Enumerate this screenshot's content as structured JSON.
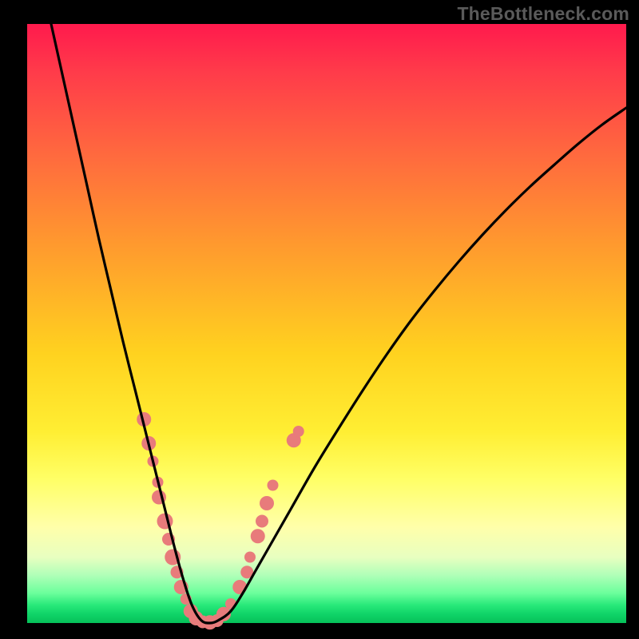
{
  "watermark": "TheBottleneck.com",
  "chart_data": {
    "type": "line",
    "title": "",
    "xlabel": "",
    "ylabel": "",
    "xlim": [
      0,
      100
    ],
    "ylim": [
      0,
      100
    ],
    "grid": false,
    "legend": false,
    "series": [
      {
        "name": "bottleneck-curve",
        "color": "#000000",
        "x": [
          4,
          6,
          8,
          10,
          12,
          14,
          16,
          18,
          20,
          21.5,
          23,
          24.5,
          26,
          27.5,
          29,
          30.5,
          32,
          34,
          36,
          38,
          40,
          44,
          48,
          52,
          56,
          60,
          64,
          68,
          72,
          76,
          80,
          84,
          88,
          92,
          96,
          100
        ],
        "y": [
          100,
          91,
          82,
          73,
          64,
          55.5,
          47,
          39,
          31,
          25,
          19,
          13,
          7.5,
          3,
          0.5,
          0,
          0.5,
          2,
          5,
          8.5,
          12,
          19,
          26,
          32.5,
          38.8,
          44.8,
          50.4,
          55.5,
          60.3,
          64.8,
          69,
          72.9,
          76.5,
          80,
          83.2,
          86
        ]
      }
    ],
    "scatter": {
      "name": "component-points",
      "color": "#e87b7b",
      "points": [
        {
          "x": 19.5,
          "y": 34,
          "r": 9
        },
        {
          "x": 20.3,
          "y": 30,
          "r": 9
        },
        {
          "x": 21.0,
          "y": 27,
          "r": 7
        },
        {
          "x": 21.8,
          "y": 23.5,
          "r": 7
        },
        {
          "x": 22.0,
          "y": 21,
          "r": 9
        },
        {
          "x": 23.0,
          "y": 17,
          "r": 10
        },
        {
          "x": 23.6,
          "y": 14,
          "r": 8
        },
        {
          "x": 24.3,
          "y": 11,
          "r": 10
        },
        {
          "x": 25.0,
          "y": 8.5,
          "r": 8
        },
        {
          "x": 25.7,
          "y": 6,
          "r": 9
        },
        {
          "x": 26.5,
          "y": 4,
          "r": 7
        },
        {
          "x": 27.3,
          "y": 2.0,
          "r": 9
        },
        {
          "x": 28.2,
          "y": 0.8,
          "r": 9
        },
        {
          "x": 29.3,
          "y": 0.2,
          "r": 8
        },
        {
          "x": 30.5,
          "y": 0.1,
          "r": 9
        },
        {
          "x": 31.7,
          "y": 0.4,
          "r": 8
        },
        {
          "x": 32.8,
          "y": 1.5,
          "r": 9
        },
        {
          "x": 34.0,
          "y": 3.2,
          "r": 7
        },
        {
          "x": 35.5,
          "y": 6.0,
          "r": 9
        },
        {
          "x": 36.7,
          "y": 8.5,
          "r": 8
        },
        {
          "x": 37.2,
          "y": 11,
          "r": 7
        },
        {
          "x": 38.5,
          "y": 14.5,
          "r": 9
        },
        {
          "x": 39.2,
          "y": 17,
          "r": 8
        },
        {
          "x": 40.0,
          "y": 20,
          "r": 9
        },
        {
          "x": 41.0,
          "y": 23,
          "r": 7
        },
        {
          "x": 44.5,
          "y": 30.5,
          "r": 9
        },
        {
          "x": 45.3,
          "y": 32,
          "r": 7
        }
      ]
    }
  }
}
